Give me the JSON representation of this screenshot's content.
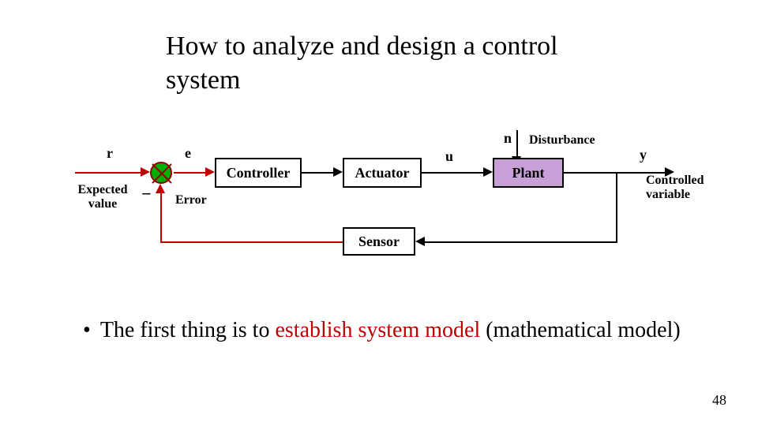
{
  "title": "How to analyze and design a control system",
  "diagram": {
    "signals": {
      "r": "r",
      "r_desc": "Expected\nvalue",
      "e": "e",
      "minus": "−",
      "error": "Error",
      "u": "u",
      "n": "n",
      "n_desc": "Disturbance",
      "y": "y",
      "y_desc": "Controlled\nvariable"
    },
    "blocks": {
      "controller": "Controller",
      "actuator": "Actuator",
      "plant": "Plant",
      "sensor": "Sensor"
    }
  },
  "bullet": {
    "lead": "The first thing is to ",
    "em": "establish system model",
    "tail": " (mathematical model)"
  },
  "page_number": "48",
  "chart_data": {
    "type": "diagram",
    "description": "Closed-loop feedback control system block diagram",
    "nodes": [
      {
        "id": "r",
        "kind": "input",
        "label": "r",
        "desc": "Expected value"
      },
      {
        "id": "sum",
        "kind": "summing",
        "inputs": [
          "r:+",
          "feedback:-"
        ],
        "output": "e"
      },
      {
        "id": "controller",
        "kind": "block",
        "label": "Controller"
      },
      {
        "id": "actuator",
        "kind": "block",
        "label": "Actuator"
      },
      {
        "id": "n",
        "kind": "input",
        "label": "n",
        "desc": "Disturbance"
      },
      {
        "id": "plant",
        "kind": "block",
        "label": "Plant"
      },
      {
        "id": "y",
        "kind": "output",
        "label": "y",
        "desc": "Controlled variable"
      },
      {
        "id": "sensor",
        "kind": "block",
        "label": "Sensor"
      }
    ],
    "edges": [
      {
        "from": "r",
        "to": "sum",
        "label": "r"
      },
      {
        "from": "sum",
        "to": "controller",
        "label": "e (Error)"
      },
      {
        "from": "controller",
        "to": "actuator"
      },
      {
        "from": "actuator",
        "to": "plant",
        "label": "u"
      },
      {
        "from": "n",
        "to": "plant",
        "label": "n (Disturbance)"
      },
      {
        "from": "plant",
        "to": "y",
        "label": "y"
      },
      {
        "from": "y",
        "to": "sensor"
      },
      {
        "from": "sensor",
        "to": "sum",
        "label": "feedback",
        "sign": "-"
      }
    ]
  }
}
